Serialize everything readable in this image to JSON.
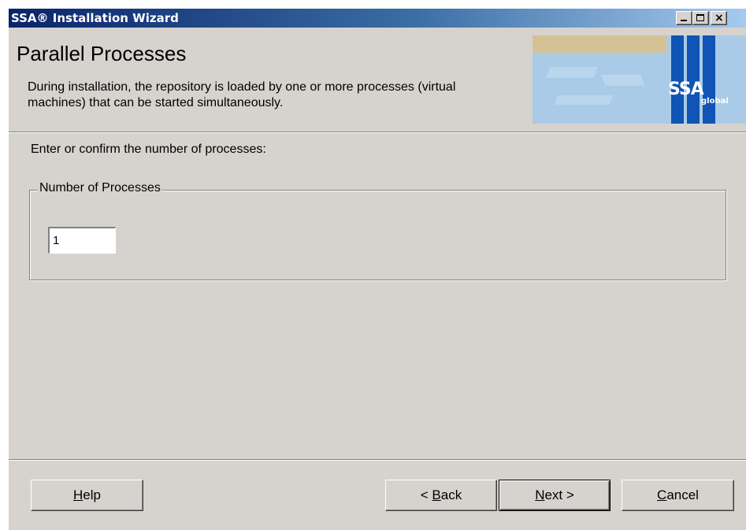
{
  "window": {
    "title": "SSA® Installation Wizard",
    "controls": {
      "minimize_icon": "minimize-icon",
      "maximize_icon": "maximize-icon",
      "close_icon": "close-icon",
      "close_glyph": "×"
    }
  },
  "header": {
    "title": "Parallel Processes",
    "description": "During installation, the repository is loaded by one or more processes (virtual machines) that can be started simultaneously.",
    "logo": {
      "brand": "SSA",
      "sub": "global"
    }
  },
  "body": {
    "prompt": "Enter or confirm the number of processes:",
    "group": {
      "label": "Number of Processes",
      "input_value": "1"
    }
  },
  "buttons": {
    "help": {
      "accel": "H",
      "rest": "elp"
    },
    "back": {
      "prefix": "< ",
      "accel": "B",
      "rest": "ack"
    },
    "next": {
      "accel": "N",
      "rest": "ext >"
    },
    "cancel": {
      "accel": "C",
      "rest": "ancel"
    }
  },
  "colors": {
    "titlebar_start": "#0a246a",
    "titlebar_end": "#a6caf0",
    "face": "#d6d3ce",
    "logo_blue": "#1054b5"
  }
}
